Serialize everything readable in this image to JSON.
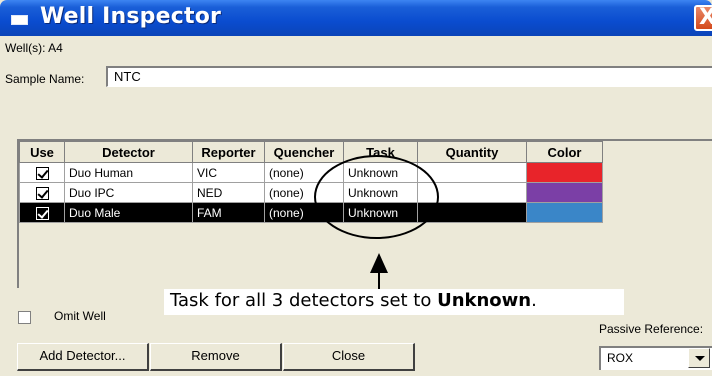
{
  "window": {
    "title": "Well Inspector",
    "close_glyph": "X"
  },
  "wells": {
    "label": "Well(s): A4"
  },
  "sample": {
    "label": "Sample Name:",
    "value": "NTC"
  },
  "grid": {
    "headers": [
      "Use",
      "Detector",
      "Reporter",
      "Quencher",
      "Task",
      "Quantity",
      "Color"
    ],
    "rows": [
      {
        "use": true,
        "detector": "Duo Human",
        "reporter": "VIC",
        "quencher": "(none)",
        "task": "Unknown",
        "quantity": "",
        "color": "#e8242a",
        "selected": false
      },
      {
        "use": true,
        "detector": "Duo IPC",
        "reporter": "NED",
        "quencher": "(none)",
        "task": "Unknown",
        "quantity": "",
        "color": "#7b3fa6",
        "selected": false
      },
      {
        "use": true,
        "detector": "Duo Male",
        "reporter": "FAM",
        "quencher": "(none)",
        "task": "Unknown",
        "quantity": "",
        "color": "#3a86c8",
        "selected": true
      }
    ]
  },
  "annotation": {
    "caption_prefix": "Task for all 3 detectors set to ",
    "caption_bold": "Unknown",
    "caption_suffix": "."
  },
  "omit_well": {
    "label": "Omit Well",
    "checked": false
  },
  "buttons": {
    "add_detector": "Add Detector...",
    "remove": "Remove",
    "close": "Close"
  },
  "passive_reference": {
    "label": "Passive Reference:",
    "value": "ROX"
  },
  "icons": {
    "window_icon": "window-icon",
    "close_icon": "close-icon",
    "dropdown_icon": "chevron-down-icon",
    "arrow": "arrow-up-icon"
  }
}
